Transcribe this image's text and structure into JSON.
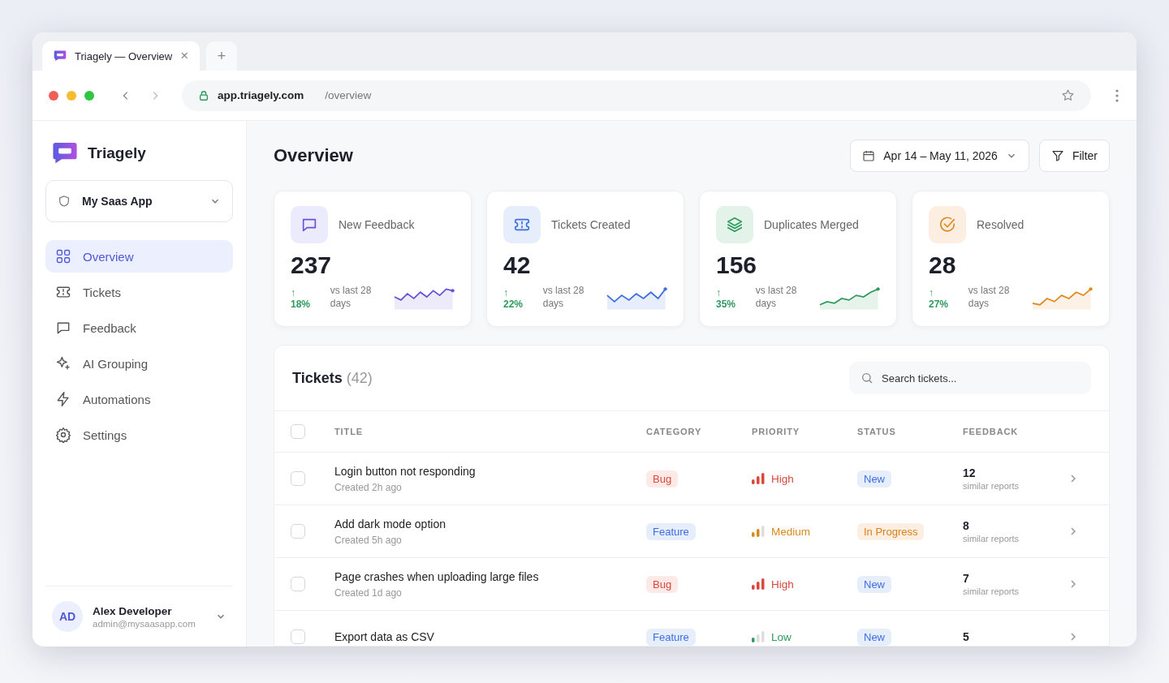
{
  "browser": {
    "tab_title": "Triagely — Overview",
    "tab_close": "×",
    "new_tab": "+",
    "url_host": "app.triagely.com",
    "url_path": "/overview"
  },
  "sidebar": {
    "brand": "Triagely",
    "workspace": "My Saas App",
    "items": [
      {
        "label": "Overview",
        "kind": "grid",
        "selected": true
      },
      {
        "label": "Tickets",
        "kind": "ticket",
        "selected": false
      },
      {
        "label": "Feedback",
        "kind": "chat",
        "selected": false
      },
      {
        "label": "AI Grouping",
        "kind": "sparkle",
        "selected": false
      },
      {
        "label": "Automations",
        "kind": "bolt",
        "selected": false
      },
      {
        "label": "Settings",
        "kind": "gear",
        "selected": false
      }
    ],
    "user": {
      "initials": "AD",
      "name": "Alex Developer",
      "email": "admin@mysaasapp.com"
    }
  },
  "header": {
    "title": "Overview",
    "date_range": "Apr 14 – May 11, 2026",
    "filter": "Filter"
  },
  "stats": [
    {
      "kind": "feedback",
      "label": "New Feedback",
      "value": "237",
      "arrow": "↑",
      "change": "18%",
      "note": "vs last 28 days"
    },
    {
      "kind": "tickets",
      "label": "Tickets Created",
      "value": "42",
      "arrow": "↑",
      "change": "22%",
      "note": "vs last 28 days"
    },
    {
      "kind": "duplicates",
      "label": "Duplicates Merged",
      "value": "156",
      "arrow": "↑",
      "change": "35%",
      "note": "vs last 28 days"
    },
    {
      "kind": "resolved",
      "label": "Resolved",
      "value": "28",
      "arrow": "↑",
      "change": "27%",
      "note": "vs last 28 days"
    }
  ],
  "tickets": {
    "title": "Tickets",
    "count": "(42)",
    "search_placeholder": "Search tickets...",
    "header_checked": false,
    "columns": [
      "TITLE",
      "CATEGORY",
      "PRIORITY",
      "STATUS",
      "FEEDBACK"
    ],
    "rows": [
      {
        "checked": false,
        "title": "Login button not responding",
        "created": "Created 2h ago",
        "category": {
          "label": "Bug",
          "kind": "bug"
        },
        "priority": {
          "label": "High",
          "kind": "high"
        },
        "status": {
          "label": "New",
          "kind": "new"
        },
        "feedback_count": "12",
        "feedback_label": "similar reports"
      },
      {
        "checked": false,
        "title": "Add dark mode option",
        "created": "Created 5h ago",
        "category": {
          "label": "Feature",
          "kind": "feature"
        },
        "priority": {
          "label": "Medium",
          "kind": "medium"
        },
        "status": {
          "label": "In Progress",
          "kind": "progress"
        },
        "feedback_count": "8",
        "feedback_label": "similar reports"
      },
      {
        "checked": false,
        "title": "Page crashes when uploading large files",
        "created": "Created 1d ago",
        "category": {
          "label": "Bug",
          "kind": "bug"
        },
        "priority": {
          "label": "High",
          "kind": "high"
        },
        "status": {
          "label": "New",
          "kind": "new"
        },
        "feedback_count": "7",
        "feedback_label": "similar reports"
      },
      {
        "checked": false,
        "title": "Export data as CSV",
        "category": {
          "label": "Feature",
          "kind": "feature"
        },
        "priority": {
          "label": "Low",
          "kind": "low"
        },
        "status": {
          "label": "New",
          "kind": "new"
        },
        "feedback_count": "5"
      }
    ]
  }
}
